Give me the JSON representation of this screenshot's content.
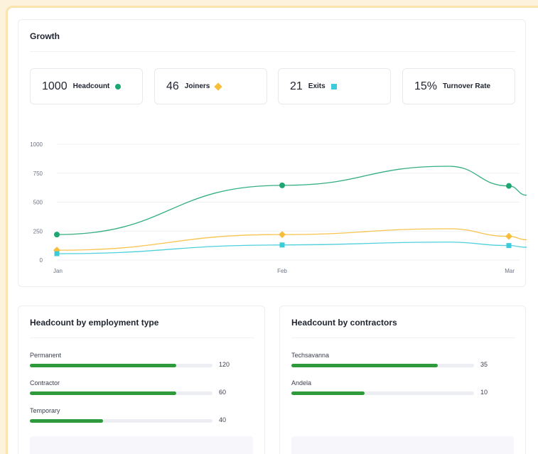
{
  "growth": {
    "title": "Growth",
    "stats": [
      {
        "value": "1000",
        "label": "Headcount",
        "marker": "circle",
        "color": "#1ea672"
      },
      {
        "value": "46",
        "label": "Joiners",
        "marker": "diamond",
        "color": "#f7bd3b"
      },
      {
        "value": "21",
        "label": "Exits",
        "marker": "square",
        "color": "#3ccbd8"
      },
      {
        "value": "15%",
        "label": "Turnover Rate",
        "marker": "none"
      }
    ]
  },
  "chart_data": {
    "type": "line",
    "categories": [
      "Jan",
      "Feb",
      "Mar"
    ],
    "ylim": [
      0,
      1000
    ],
    "yticks": [
      "1000",
      "750",
      "500",
      "250",
      "0"
    ],
    "grid": true,
    "series": [
      {
        "values": [
          220,
          645,
          640
        ],
        "color": "#1ea672",
        "marker": "circle"
      },
      {
        "values": [
          85,
          220,
          205
        ],
        "color": "#f7bd3b",
        "marker": "diamond"
      },
      {
        "values": [
          55,
          130,
          125
        ],
        "color": "#3ccbd8",
        "marker": "square"
      }
    ]
  },
  "employment": {
    "title": "Headcount by employment type",
    "max": 150,
    "rows": [
      {
        "label": "Permanent",
        "value": "120",
        "fraction": 0.8
      },
      {
        "label": "Contractor",
        "value": "60",
        "fraction": 0.8
      },
      {
        "label": "Temporary",
        "value": "40",
        "fraction": 0.4
      }
    ]
  },
  "contractors": {
    "title": "Headcount by contractors",
    "rows": [
      {
        "label": "Techsavanna",
        "value": "35",
        "fraction": 0.8
      },
      {
        "label": "Andela",
        "value": "10",
        "fraction": 0.4
      }
    ]
  },
  "colors": {
    "bar": "#2e9a3c",
    "track": "#eceef4"
  }
}
